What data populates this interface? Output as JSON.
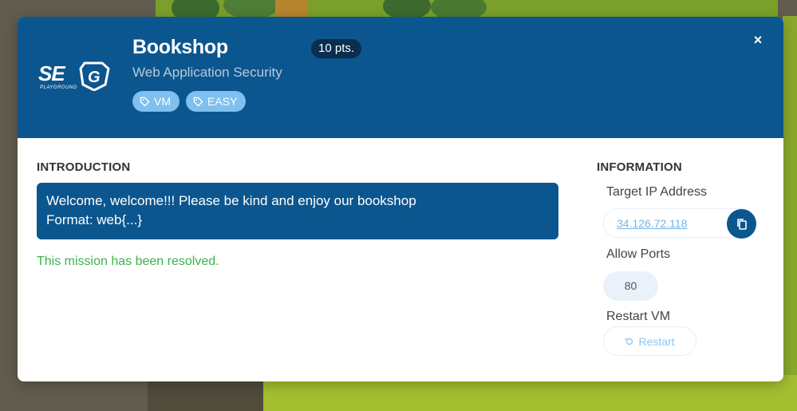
{
  "challenge": {
    "title": "Bookshop",
    "category": "Web Application Security",
    "points": "10 pts.",
    "tags": [
      "VM",
      "EASY"
    ],
    "close_icon": "×"
  },
  "logo": {
    "text": "SEG",
    "subtext": "PLAYGROUND"
  },
  "introduction": {
    "heading": "INTRODUCTION",
    "lines": [
      "Welcome, welcome!!! Please be kind and enjoy our bookshop",
      "Format: web{...}"
    ],
    "status": "This mission has been resolved."
  },
  "information": {
    "heading": "INFORMATION",
    "target_ip_label": "Target IP Address",
    "target_ip": "34.126.72.118",
    "allow_ports_label": "Allow Ports",
    "ports": [
      "80"
    ],
    "restart_label": "Restart VM",
    "restart_button": "Restart"
  },
  "colors": {
    "header_bg": "#0c568f",
    "tag_bg": "#7ec0ef",
    "resolved": "#3bb44a",
    "link": "#74b4e6"
  },
  "icons": [
    "tag-icon",
    "copy-icon",
    "restart-icon",
    "close-icon"
  ]
}
